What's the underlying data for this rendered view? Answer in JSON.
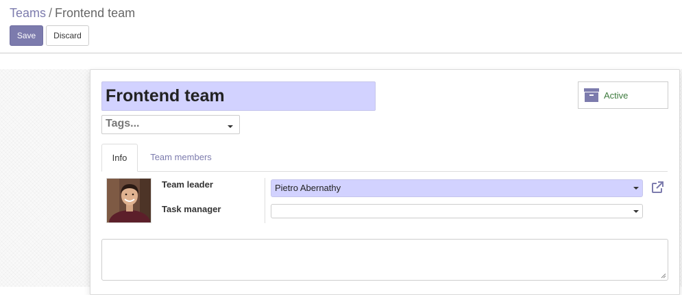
{
  "breadcrumb": {
    "parent": "Teams",
    "separator": "/",
    "current": "Frontend team"
  },
  "toolbar": {
    "save_label": "Save",
    "discard_label": "Discard"
  },
  "form": {
    "name": "Frontend team",
    "tags_placeholder": "Tags...",
    "status_button_label": "Active",
    "tabs": [
      {
        "label": "Info",
        "active": true
      },
      {
        "label": "Team members",
        "active": false
      }
    ],
    "fields": {
      "team_leader_label": "Team leader",
      "team_leader_value": "Pietro Abernathy",
      "task_manager_label": "Task manager",
      "task_manager_value": ""
    },
    "description_value": ""
  },
  "icons": {
    "status": "archive-icon",
    "external": "external-link-icon",
    "dropdown": "caret-down-icon"
  },
  "colors": {
    "accent": "#7c7bad",
    "field_highlight": "#d2d2ff",
    "active_text": "#3c7a3c"
  }
}
